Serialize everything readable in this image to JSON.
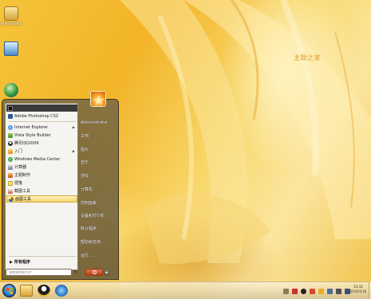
{
  "desktop": {
    "icons": [
      {
        "label": "Administrator",
        "icon": "user-folder-icon"
      },
      {
        "label": "",
        "icon": "computer-icon"
      },
      {
        "label": "",
        "icon": "network-icon"
      }
    ],
    "watermark": "主题之家"
  },
  "start_menu": {
    "pinned": [
      {
        "label": "",
        "icon": "terminal-icon"
      },
      {
        "label": "Adobe Photoshop CS2",
        "icon": "photoshop-icon"
      }
    ],
    "recent": [
      {
        "label": "Internet Explorer",
        "icon": "ie-icon",
        "submenu": true
      },
      {
        "label": "Vista Style Builder",
        "icon": "style-builder-icon",
        "submenu": false
      },
      {
        "label": "腾讯QQ2009",
        "icon": "qq-icon",
        "submenu": false
      },
      {
        "label": "入门",
        "icon": "getting-started-icon",
        "submenu": true
      },
      {
        "label": "Windows Media Center",
        "icon": "media-center-icon",
        "submenu": false
      },
      {
        "label": "计算器",
        "icon": "calculator-icon",
        "submenu": false
      },
      {
        "label": "主题制作",
        "icon": "theme-maker-icon",
        "submenu": false
      },
      {
        "label": "便笺",
        "icon": "sticky-notes-icon",
        "submenu": false
      },
      {
        "label": "截图工具",
        "icon": "snipping-tool-icon",
        "submenu": false
      },
      {
        "label": "画图工具",
        "icon": "paint-icon",
        "submenu": false
      }
    ],
    "all_programs": "所有程序",
    "search_placeholder": "搜索程序和文件",
    "right_links": [
      {
        "label": "Administrator"
      },
      {
        "label": "文档"
      },
      {
        "label": "图片"
      },
      {
        "label": "音乐"
      },
      {
        "label": "游戏"
      },
      {
        "label": "计算机"
      },
      {
        "label": "控制面板"
      },
      {
        "label": "设备和打印机"
      },
      {
        "label": "默认程序"
      },
      {
        "label": "帮助和支持"
      },
      {
        "label": "运行..."
      }
    ],
    "shutdown_icon": "power-icon",
    "more_icon": "chevron-right-icon"
  },
  "taskbar": {
    "pinned": [
      {
        "icon": "explorer-folder-icon"
      },
      {
        "icon": "qq-icon"
      },
      {
        "icon": "ie-icon"
      }
    ],
    "clock": {
      "time": "23:32",
      "date": "2010/1/16"
    }
  },
  "colors": {
    "start_menu": "#6f6244",
    "highlight": "#f2d36a",
    "taskbar": "#e6dcc0"
  }
}
